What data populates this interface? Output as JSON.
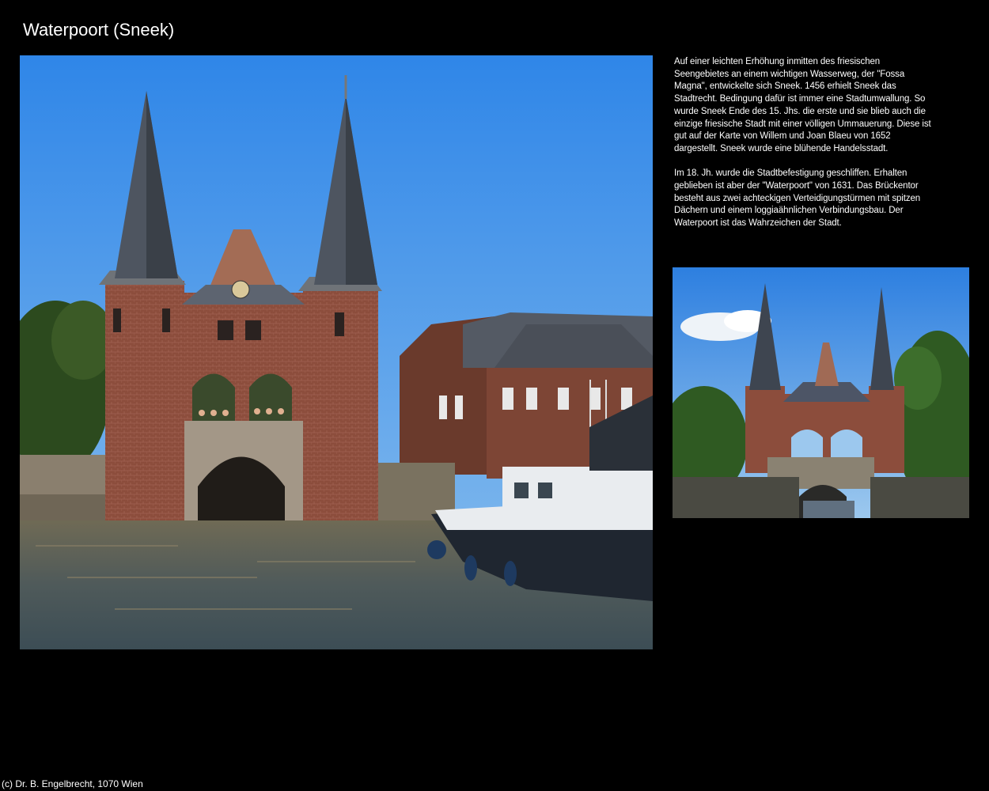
{
  "page": {
    "title": "Waterpoort (Sneek)",
    "footer": "(c) Dr. B. Engelbrecht, 1070 Wien"
  },
  "description": {
    "paragraphs": [
      "Auf einer leichten Erhöhung inmitten des friesischen Seengebietes an einem wichtigen Wasserweg, der \"Fossa Magna\", entwickelte sich Sneek. 1456 erhielt Sneek das Stadtrecht. Bedingung dafür ist immer eine Stadtumwallung. So wurde Sneek Ende des 15. Jhs. die erste und sie blieb auch die einzige friesische Stadt mit einer völligen Ummauerung. Diese ist gut auf der Karte von Willem und Joan Blaeu von 1652 dargestellt. Sneek wurde eine blühende Handelsstadt.",
      "Im 18. Jh. wurde die Stadtbefestigung geschliffen. Erhalten geblieben ist aber der \"Waterpoort\" von 1631. Das Brückentor besteht aus zwei achteckigen Verteidigungstürmen mit spitzen Dächern und einem loggiaähnlichen Verbindungsbau. Der Waterpoort ist das Wahrzeichen der Stadt."
    ]
  },
  "colors": {
    "background": "#000000",
    "text": "#ffffff",
    "sky": "#3f8fe6",
    "brick": "#8a4a3a",
    "water": "#5b5a4a"
  },
  "icons": {
    "main_photo": "photo-waterpoort-front",
    "side_photo": "photo-waterpoort-distant"
  }
}
